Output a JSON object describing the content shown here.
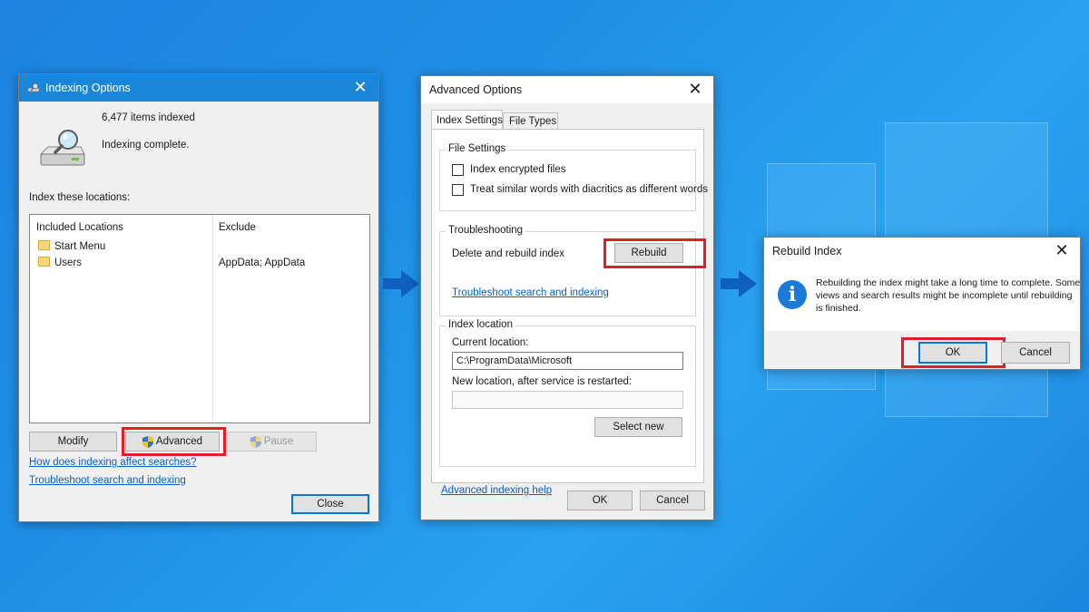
{
  "indexing": {
    "title": "Indexing Options",
    "items_indexed": "6,477 items indexed",
    "status": "Indexing complete.",
    "locations_label": "Index these locations:",
    "columns": {
      "included": "Included Locations",
      "exclude": "Exclude"
    },
    "rows": [
      {
        "name": "Start Menu",
        "exclude": ""
      },
      {
        "name": "Users",
        "exclude": "AppData; AppData"
      }
    ],
    "modify_label": "Modify",
    "advanced_label": "Advanced",
    "pause_label": "Pause",
    "link_affect": "How does indexing affect searches?",
    "link_troubleshoot": "Troubleshoot search and indexing",
    "close_label": "Close"
  },
  "advanced": {
    "title": "Advanced Options",
    "tab_index_settings": "Index Settings",
    "tab_file_types": "File Types",
    "file_settings_title": "File Settings",
    "checkbox_encrypted": "Index encrypted files",
    "checkbox_diacritics": "Treat similar words with diacritics as different words",
    "troubleshooting_title": "Troubleshooting",
    "rebuild_text": "Delete and rebuild index",
    "rebuild_label": "Rebuild",
    "troubleshoot_link": "Troubleshoot search and indexing",
    "index_location_title": "Index location",
    "current_location_label": "Current location:",
    "current_location_value": "C:\\ProgramData\\Microsoft",
    "new_location_label": "New location, after service is restarted:",
    "new_location_value": "",
    "select_new_label": "Select new",
    "help_link": "Advanced indexing help",
    "ok_label": "OK",
    "cancel_label": "Cancel"
  },
  "rebuild": {
    "title": "Rebuild Index",
    "message_line1": "Rebuilding the index might take a long time to complete. Some",
    "message_line2": "views and search results might be incomplete until rebuilding",
    "message_line3": "is finished.",
    "ok_label": "OK",
    "cancel_label": "Cancel"
  },
  "colors": {
    "titlebar_active": "#1a86d9",
    "highlight": "#e11f26",
    "arrow": "#0f5fc0",
    "link": "#0b5fc9"
  },
  "icons": [
    "magnifier-drive-icon",
    "folder-icon",
    "shield-icon",
    "info-icon",
    "close-icon",
    "arrow-right-icon"
  ]
}
